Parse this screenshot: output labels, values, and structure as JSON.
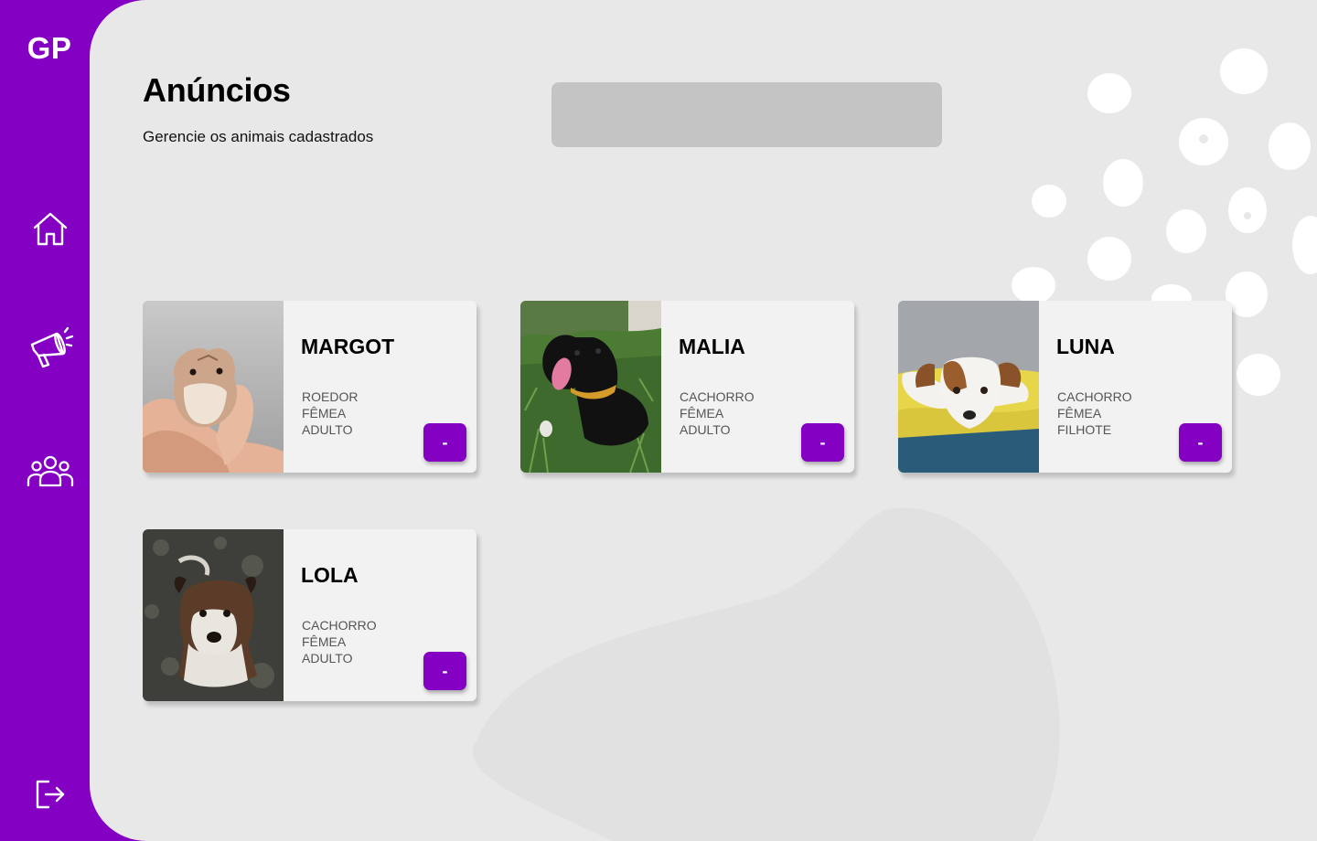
{
  "app": {
    "logo": "GP"
  },
  "sidebar": {
    "items": [
      {
        "name": "home",
        "icon": "home-icon"
      },
      {
        "name": "anuncios",
        "icon": "megaphone-icon"
      },
      {
        "name": "usuarios",
        "icon": "users-icon"
      }
    ],
    "logout_icon": "logout-icon"
  },
  "header": {
    "title": "Anúncios",
    "subtitle": "Gerencie os animais cadastrados"
  },
  "search": {
    "value": "",
    "placeholder": ""
  },
  "cards": [
    {
      "name": "MARGOT",
      "species": "ROEDOR",
      "sex": "FÊMEA",
      "age": "ADULTO",
      "button_label": "-",
      "photo": "hamster-photo"
    },
    {
      "name": "MALIA",
      "species": "CACHORRO",
      "sex": "FÊMEA",
      "age": "ADULTO",
      "button_label": "-",
      "photo": "black-dog-photo"
    },
    {
      "name": "LUNA",
      "species": "CACHORRO",
      "sex": "FÊMEA",
      "age": "FILHOTE",
      "button_label": "-",
      "photo": "brown-white-puppy-photo"
    },
    {
      "name": "LOLA",
      "species": "CACHORRO",
      "sex": "FÊMEA",
      "age": "ADULTO",
      "button_label": "-",
      "photo": "brindle-dog-photo"
    }
  ],
  "colors": {
    "primary": "#8400C3",
    "background": "#E8E8E8",
    "card": "#F2F2F2",
    "search": "#C4C4C4"
  }
}
